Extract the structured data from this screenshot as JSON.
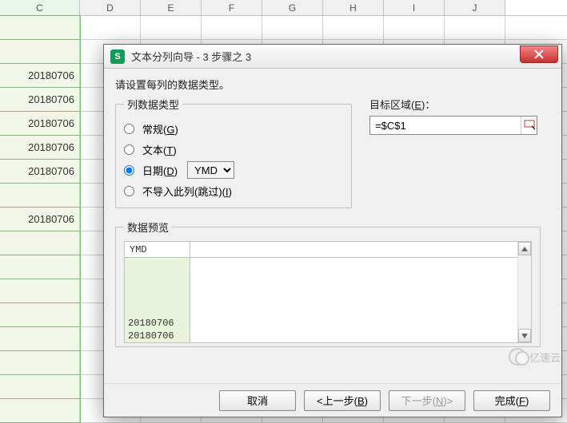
{
  "sheet": {
    "column_headers": [
      "C",
      "D",
      "E",
      "F",
      "G",
      "H",
      "I",
      "J"
    ],
    "rows": [
      "",
      "",
      "20180706",
      "20180706",
      "20180706",
      "20180706",
      "20180706",
      "",
      "20180706",
      "",
      "",
      "",
      "",
      "",
      "",
      "",
      ""
    ]
  },
  "dialog": {
    "app_icon_letter": "S",
    "title": "文本分列向导 - 3 步骤之 3",
    "instruction": "请设置每列的数据类型。",
    "group_type_legend": "列数据类型",
    "radios": {
      "general": {
        "label": "常规",
        "key": "G"
      },
      "text": {
        "label": "文本",
        "key": "T"
      },
      "date": {
        "label": "日期",
        "key": "D",
        "combo": "YMD"
      },
      "skip": {
        "label": "不导入此列(跳过)",
        "key": "I"
      }
    },
    "selected_radio": "date",
    "dest_label": "目标区域",
    "dest_key": "E",
    "dest_value": "=$C$1",
    "preview_legend": "数据预览",
    "preview_header": "YMD",
    "preview_rows": [
      "20180706",
      "20180706"
    ],
    "buttons": {
      "cancel": "取消",
      "back_text": "<上一步",
      "back_key": "B",
      "next_text": "下一步",
      "next_key": "N",
      "next_suffix": ">",
      "finish_text": "完成",
      "finish_key": "F"
    }
  },
  "watermark": "亿速云"
}
